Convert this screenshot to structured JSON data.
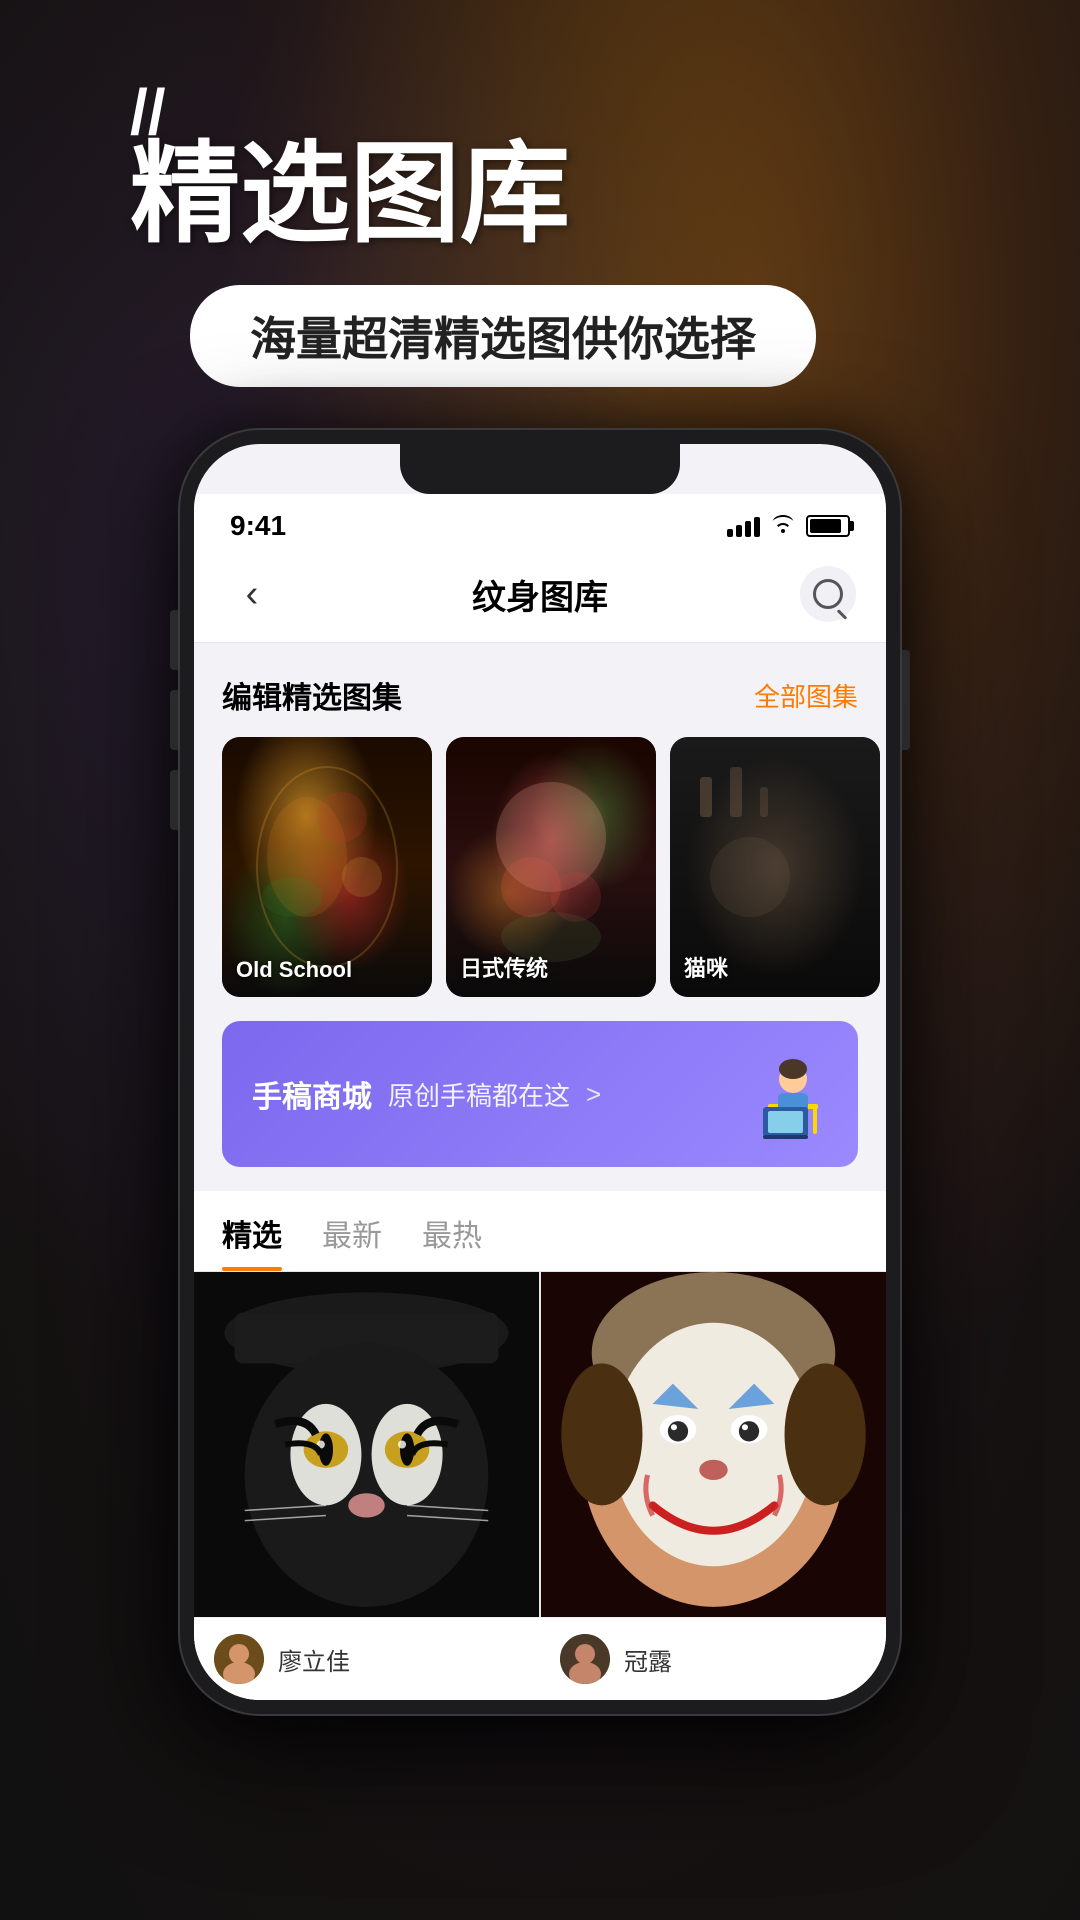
{
  "background": {
    "color": "#1a1a1a"
  },
  "header": {
    "quote_mark": "//",
    "title": "精选图库",
    "subtitle": "海量超清精选图供你选择"
  },
  "phone": {
    "status_bar": {
      "time": "9:41",
      "signal_alt": "signal bars",
      "wifi_alt": "wifi",
      "battery_alt": "battery"
    },
    "nav": {
      "back_label": "‹",
      "title": "纹身图库",
      "search_label": "🔍"
    },
    "editor_picks": {
      "section_title": "编辑精选图集",
      "section_link": "全部图集",
      "items": [
        {
          "label": "Old School",
          "style": "gallery-item-1"
        },
        {
          "label": "日式传统",
          "style": "gallery-item-2"
        },
        {
          "label": "猫咪",
          "style": "gallery-item-3"
        }
      ]
    },
    "banner": {
      "title": "手稿商城",
      "subtitle": "原创手稿都在这",
      "arrow": ">"
    },
    "tabs": [
      {
        "label": "精选",
        "active": true
      },
      {
        "label": "最新",
        "active": false
      },
      {
        "label": "最热",
        "active": false
      }
    ],
    "gallery": [
      {
        "type": "tiger",
        "author_name": "廖立佳"
      },
      {
        "type": "clown",
        "author_name": "冠露"
      }
    ]
  }
}
